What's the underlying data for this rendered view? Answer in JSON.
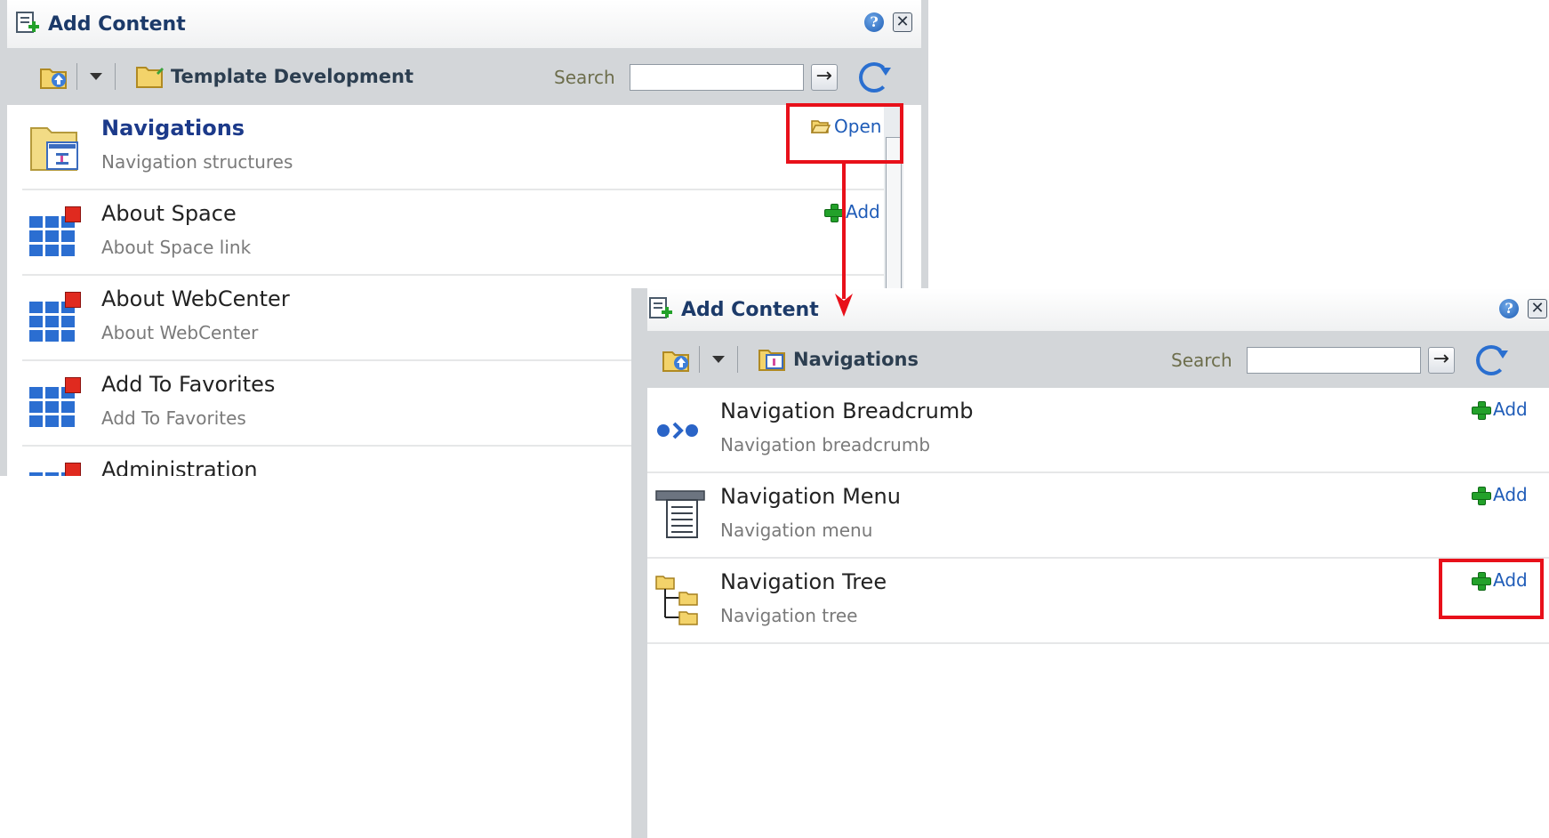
{
  "dialog_back": {
    "title": "Add Content",
    "breadcrumb": "Template Development",
    "search_label": "Search",
    "search_value": "",
    "items": [
      {
        "name": "Navigations",
        "desc": "Navigation structures",
        "action": "Open"
      },
      {
        "name": "About Space",
        "desc": "About Space link",
        "action": "Add"
      },
      {
        "name": "About WebCenter",
        "desc": "About WebCenter"
      },
      {
        "name": "Add To Favorites",
        "desc": "Add To Favorites"
      },
      {
        "name": "Administration"
      }
    ]
  },
  "dialog_front": {
    "title": "Add Content",
    "breadcrumb": "Navigations",
    "search_label": "Search",
    "search_value": "",
    "items": [
      {
        "name": "Navigation Breadcrumb",
        "desc": "Navigation breadcrumb",
        "action": "Add"
      },
      {
        "name": "Navigation Menu",
        "desc": "Navigation menu",
        "action": "Add"
      },
      {
        "name": "Navigation Tree",
        "desc": "Navigation tree",
        "action": "Add"
      }
    ]
  },
  "icons": {
    "help": "?",
    "close": "✕",
    "go": "→"
  },
  "colors": {
    "highlight": "#e8101a",
    "link": "#1f5cb8",
    "title": "#1c3a69"
  }
}
